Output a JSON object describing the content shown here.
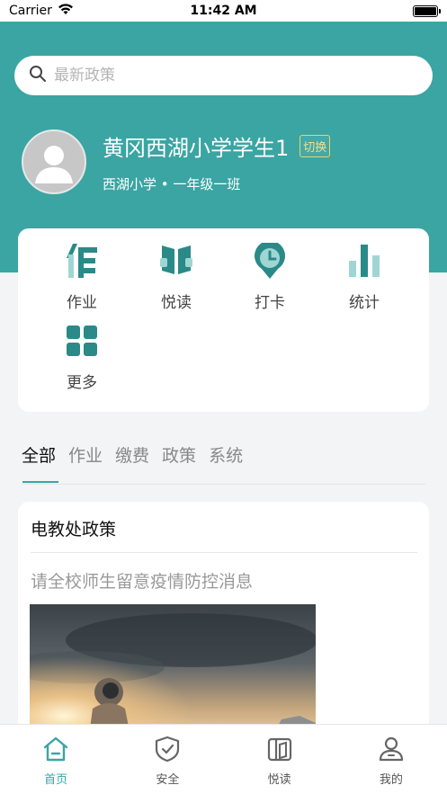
{
  "status_bar": {
    "carrier": "Carrier",
    "time": "11:42 AM"
  },
  "search": {
    "placeholder": "最新政策"
  },
  "profile": {
    "name": "黄冈西湖小学学生1",
    "switch_label": "切换",
    "school_class": "西湖小学 • 一年级一班"
  },
  "features": [
    {
      "label": "作业",
      "icon": "homework-icon"
    },
    {
      "label": "悦读",
      "icon": "book-reading-icon"
    },
    {
      "label": "打卡",
      "icon": "clock-pin-icon"
    },
    {
      "label": "统计",
      "icon": "bar-chart-icon"
    },
    {
      "label": "更多",
      "icon": "grid-more-icon"
    }
  ],
  "tabs": [
    "全部",
    "作业",
    "缴费",
    "政策",
    "系统"
  ],
  "active_tab": "全部",
  "news": {
    "title": "电教处政策",
    "body": "请全校师生留意疫情防控消息"
  },
  "tabbar": [
    {
      "label": "首页",
      "icon": "home-icon",
      "active": true
    },
    {
      "label": "安全",
      "icon": "shield-icon",
      "active": false
    },
    {
      "label": "悦读",
      "icon": "books-icon",
      "active": false
    },
    {
      "label": "我的",
      "icon": "user-icon",
      "active": false
    }
  ],
  "colors": {
    "primary": "#3aa5a3",
    "badge_border": "#e9d56a",
    "background": "#f2f4f5"
  }
}
